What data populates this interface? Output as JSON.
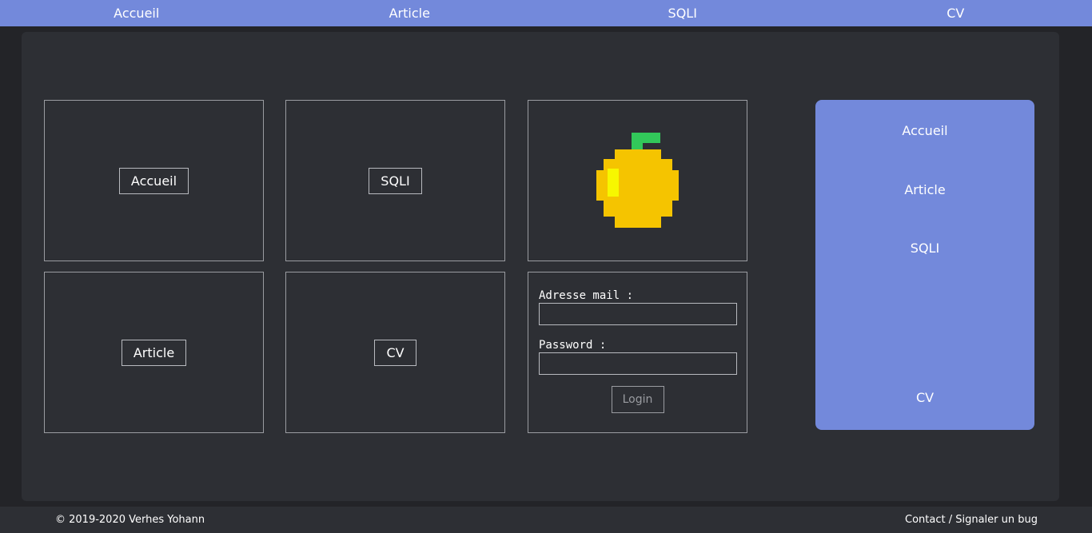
{
  "topnav": {
    "items": [
      {
        "label": "Accueil"
      },
      {
        "label": "Article"
      },
      {
        "label": "SQLI"
      },
      {
        "label": "CV"
      }
    ]
  },
  "tiles": {
    "accueil": "Accueil",
    "sqli": "SQLI",
    "article": "Article",
    "cv": "CV"
  },
  "login_form": {
    "email_label": "Adresse mail :",
    "email_value": "",
    "password_label": "Password :",
    "password_value": "",
    "login_button": "Login"
  },
  "logo": {
    "icon": "pixel-fruit-icon",
    "colors": {
      "body": "#f5c400",
      "leaf": "#32c85a",
      "highlight": "#f7f700"
    }
  },
  "sidebar": {
    "items": [
      {
        "label": "Accueil"
      },
      {
        "label": "Article"
      },
      {
        "label": "SQLI"
      },
      {
        "label": "CV"
      }
    ]
  },
  "footer": {
    "copyright": "© 2019-2020 Verhes Yohann",
    "contact": "Contact / Signaler un bug"
  },
  "colors": {
    "accent": "#7389db",
    "panel": "#2d2f34",
    "background": "#232428"
  }
}
